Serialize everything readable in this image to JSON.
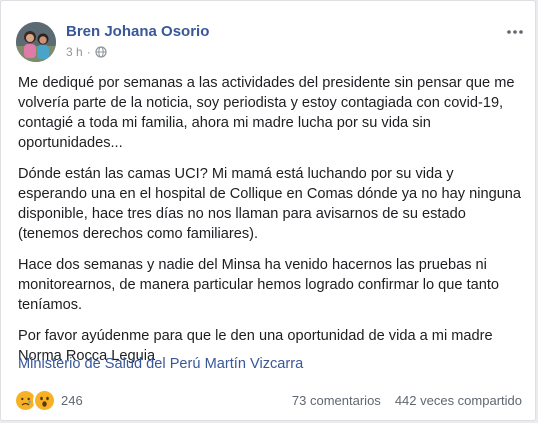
{
  "post": {
    "author": "Bren Johana Osorio",
    "time": "3 h",
    "audience_icon": "globe-icon",
    "more_icon": "ellipsis-icon"
  },
  "body": {
    "paragraphs": [
      "Me dediqué por semanas a las actividades del presidente sin pensar que me volvería parte de la noticia, soy periodista y estoy contagiada con covid-19, contagié a toda mi familia, ahora mi madre lucha por su vida sin oportunidades...",
      "Dónde están las camas UCI? Mi mamá está luchando por su vida y esperando una en el hospital de Collique en Comas dónde ya no hay ninguna disponible, hace tres días no nos llaman para avisarnos de su estado (tenemos derechos como familiares).",
      "Hace dos semanas y nadie del Minsa ha venido hacernos las pruebas ni monitorearnos, de manera particular hemos logrado confirmar lo que tanto teníamos.",
      "Por favor ayúdenme para que le den una oportunidad de vida a mi madre Norma Rocca Leguia"
    ],
    "tagged": "Ministerio de Salud del Perú Martín Vizcarra"
  },
  "footer": {
    "reactions": [
      "sad-reaction-icon",
      "wow-reaction-icon"
    ],
    "reaction_count": "246",
    "comments": "73 comentarios",
    "shares": "442 veces compartido"
  },
  "colors": {
    "link": "#385898",
    "text": "#1c1e21",
    "muted": "#606770",
    "reaction_yellow": "#f7b125"
  }
}
